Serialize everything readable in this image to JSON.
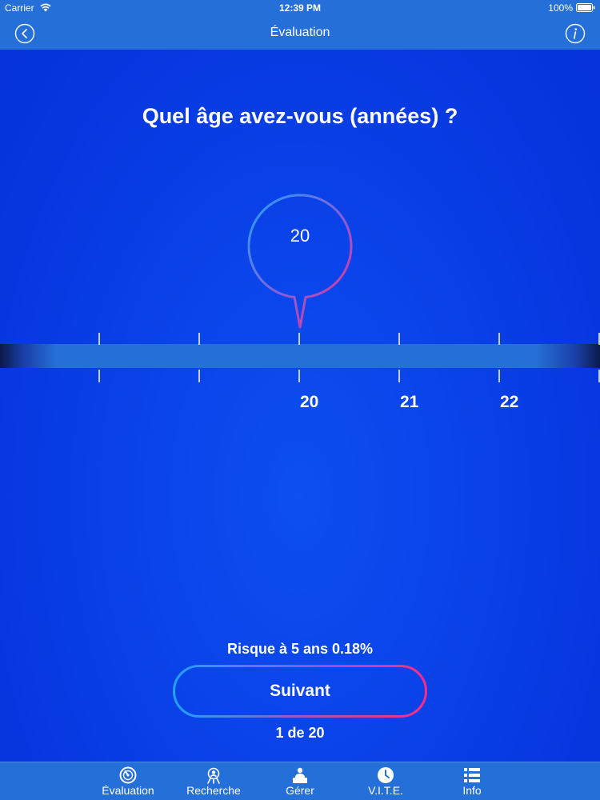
{
  "status_bar": {
    "carrier": "Carrier",
    "time": "12:39 PM",
    "battery": "100%"
  },
  "nav": {
    "title": "Évaluation",
    "back_icon": "chevron-left-circle-icon",
    "info_icon": "info-circle-icon"
  },
  "question": "Quel âge avez-vous (années) ?",
  "slider": {
    "selected_value": "20",
    "tick_labels": [
      "20",
      "21",
      "22"
    ]
  },
  "risk_text": "Risque à 5 ans 0.18%",
  "next_button": {
    "label": "Suivant"
  },
  "progress": "1 de 20",
  "tabs": [
    {
      "label": "Évaluation",
      "icon": "gauge-icon"
    },
    {
      "label": "Recherche",
      "icon": "research-icon"
    },
    {
      "label": "Gérer",
      "icon": "person-desk-icon"
    },
    {
      "label": "V.I.T.E.",
      "icon": "clock-icon"
    },
    {
      "label": "Info",
      "icon": "list-icon"
    }
  ],
  "colors": {
    "background": "#0a44ea",
    "bars": "#2470d8",
    "accent_pink": "#ff2a86",
    "accent_blue": "#1fa3ff"
  }
}
